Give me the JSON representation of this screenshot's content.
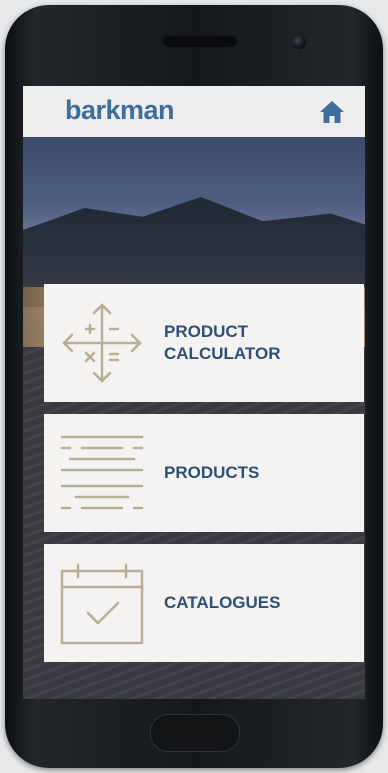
{
  "app": {
    "brand": "barkman",
    "brand_color": "#3e6e9b",
    "accent_color": "#2e4f78",
    "icon_color": "#b9ae98"
  },
  "header": {
    "logo_text": "barkman",
    "home_icon": "home-icon"
  },
  "menu": {
    "items": [
      {
        "label": "PRODUCT\nCALCULATOR",
        "icon": "calculator-cross-icon"
      },
      {
        "label": "PRODUCTS",
        "icon": "list-lines-icon"
      },
      {
        "label": "CATALOGUES",
        "icon": "calendar-check-icon"
      }
    ]
  }
}
